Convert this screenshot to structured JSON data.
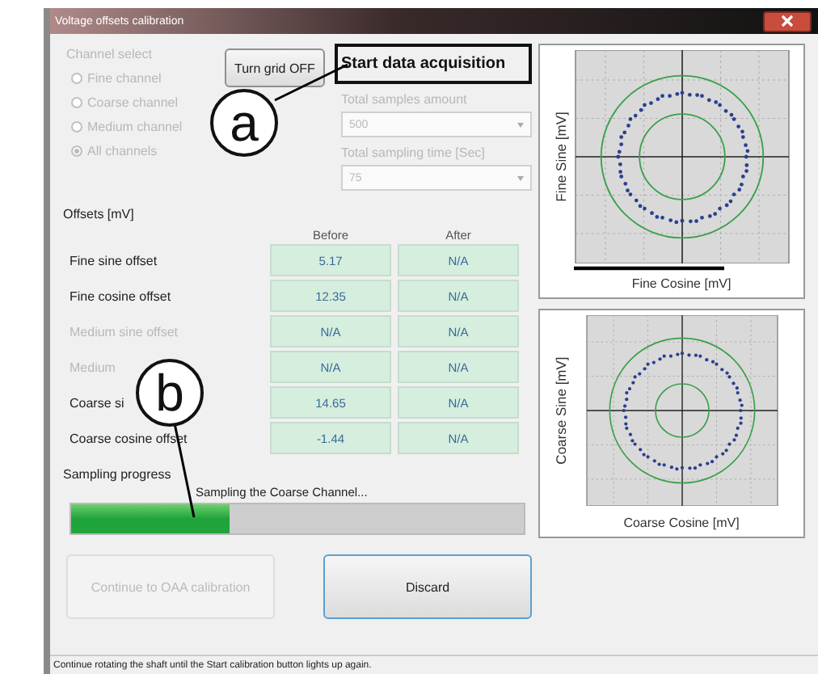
{
  "window": {
    "title": "Voltage offsets calibration"
  },
  "channel_select": {
    "label": "Channel select",
    "disabled": true,
    "options": [
      {
        "label": "Fine channel",
        "selected": false
      },
      {
        "label": "Coarse channel",
        "selected": false
      },
      {
        "label": "Medium channel",
        "selected": false
      },
      {
        "label": "All channels",
        "selected": true
      }
    ]
  },
  "grid_button": "Turn grid OFF",
  "acquisition": {
    "title": "Start data acquisition",
    "disabled": true,
    "samples_label": "Total samples amount",
    "samples_value": "500",
    "time_label": "Total sampling time [Sec]",
    "time_value": "75"
  },
  "offsets": {
    "title": "Offsets [mV]",
    "headers": [
      "Before",
      "After"
    ],
    "rows": [
      {
        "name": "Fine sine offset",
        "before": "5.17",
        "after": "N/A",
        "disabled": false
      },
      {
        "name": "Fine cosine offset",
        "before": "12.35",
        "after": "N/A",
        "disabled": false
      },
      {
        "name": "Medium sine offset",
        "before": "N/A",
        "after": "N/A",
        "disabled": true
      },
      {
        "name": "Medium",
        "before": "N/A",
        "after": "N/A",
        "disabled": true
      },
      {
        "name": "Coarse si",
        "before": "14.65",
        "after": "N/A",
        "disabled": false
      },
      {
        "name": "Coarse cosine offset",
        "before": "-1.44",
        "after": "N/A",
        "disabled": false
      }
    ]
  },
  "progress": {
    "label": "Sampling progress",
    "message": "Sampling the Coarse Channel...",
    "level": 0.35
  },
  "buttons": [
    {
      "label": "Continue to OAA calibration",
      "disabled": true
    },
    {
      "label": "Discard",
      "disabled": false
    }
  ],
  "plots": [
    {
      "xlabel": "Fine Cosine [mV]",
      "ylabel": "Fine Sine [mV]"
    },
    {
      "xlabel": "Coarse Cosine [mV]",
      "ylabel": "Coarse Sine [mV]"
    }
  ],
  "status_bar": "Continue rotating the shaft until the Start calibration button lights up again.",
  "annotations": [
    {
      "label": "a"
    },
    {
      "label": "b"
    }
  ]
}
